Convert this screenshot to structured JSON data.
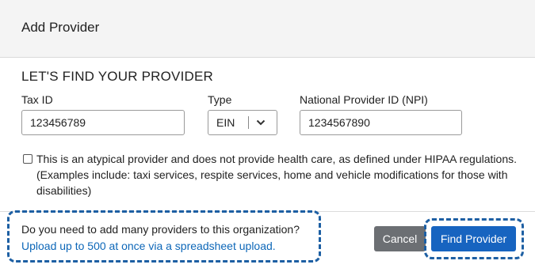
{
  "modal": {
    "title": "Add Provider",
    "section_title": "LET'S FIND YOUR PROVIDER"
  },
  "form": {
    "tax_id": {
      "label": "Tax ID",
      "value": "123456789"
    },
    "type": {
      "label": "Type",
      "selected": "EIN"
    },
    "npi": {
      "label": "National Provider ID (NPI)",
      "value": "1234567890"
    },
    "atypical": {
      "checked": false,
      "text": "This is an atypical provider and does not provide health care, as defined under HIPAA regulations. (Examples include: taxi services, respite services, home and vehicle modifications for those with disabilities)"
    }
  },
  "footer": {
    "question": "Do you need to add many providers to this organization?",
    "link": "Upload up to 500 at once via a spreadsheet upload.",
    "cancel_label": "Cancel",
    "find_label": "Find Provider"
  },
  "colors": {
    "header_bg": "#f4f4f4",
    "highlight_dash": "#1d5fa3",
    "primary_button": "#1764c0",
    "secondary_button": "#6c6f73",
    "link": "#0d67b8"
  },
  "icons": [
    "chevron-down-icon"
  ]
}
